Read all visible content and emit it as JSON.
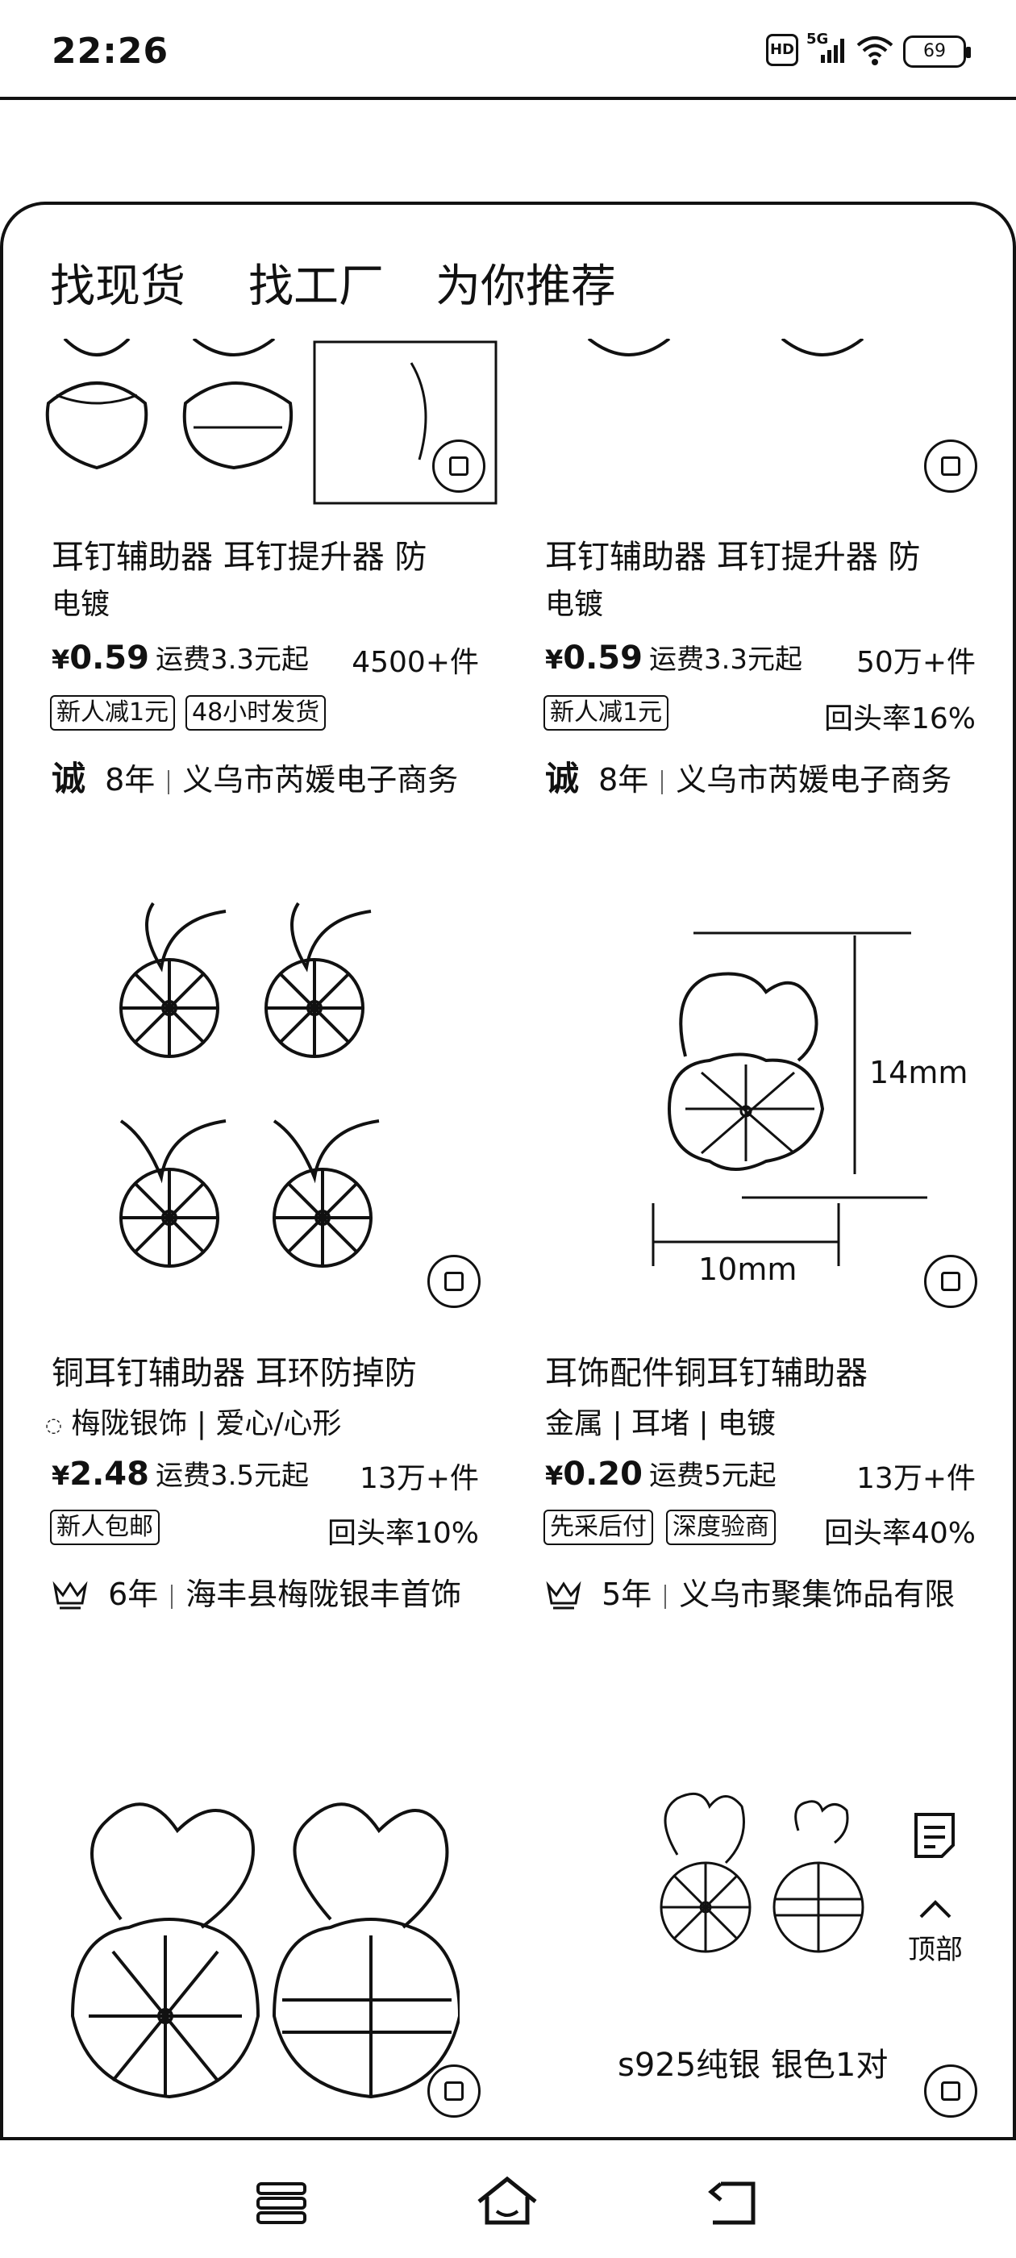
{
  "status_bar": {
    "time": "22:26",
    "hd_badge": "HD",
    "network": "5G",
    "battery": "69"
  },
  "tabs": [
    "找现货",
    "找工厂",
    "为你推荐"
  ],
  "products": [
    {
      "title": "耳钉辅助器 耳钉提升器 防",
      "subtitle": "电镀",
      "price_symbol": "¥",
      "price": "0.59",
      "shipping": "运费3.3元起",
      "sold": "4500+件",
      "tags": [
        "新人减1元",
        "48小时发货"
      ],
      "rebuy": "",
      "shop_years": "8年",
      "shop_name": "义乌市芮媛电子商务",
      "shop_badge_icon": "cheng-integrity-icon"
    },
    {
      "title": "耳钉辅助器 耳钉提升器 防",
      "subtitle": "电镀",
      "price_symbol": "¥",
      "price": "0.59",
      "shipping": "运费3.3元起",
      "sold": "50万+件",
      "tags": [
        "新人减1元"
      ],
      "rebuy": "回头率16%",
      "shop_years": "8年",
      "shop_name": "义乌市芮媛电子商务",
      "shop_badge_icon": "cheng-integrity-icon"
    },
    {
      "title": "铜耳钉辅助器 耳环防掉防",
      "subtitle": "梅陇银饰 | 爱心/心形",
      "price_symbol": "¥",
      "price": "2.48",
      "shipping": "运费3.5元起",
      "sold": "13万+件",
      "tags": [
        "新人包邮"
      ],
      "rebuy": "回头率10%",
      "shop_years": "6年",
      "shop_name": "海丰县梅陇银丰首饰",
      "shop_badge_icon": "crown-shop-icon"
    },
    {
      "title": "耳饰配件铜耳钉辅助器",
      "subtitle": "金属 | 耳堵 | 电镀",
      "price_symbol": "¥",
      "price": "0.20",
      "shipping": "运费5元起",
      "sold": "13万+件",
      "tags": [
        "先采后付",
        "深度验商"
      ],
      "rebuy": "回头率40%",
      "shop_years": "5年",
      "shop_name": "义乌市聚集饰品有限",
      "shop_badge_icon": "crown-shop-icon"
    }
  ],
  "image_labels": {
    "height": "14mm",
    "width": "10mm",
    "material": "s925纯银 银色1对"
  },
  "side_tools": {
    "top_label": "顶部"
  }
}
